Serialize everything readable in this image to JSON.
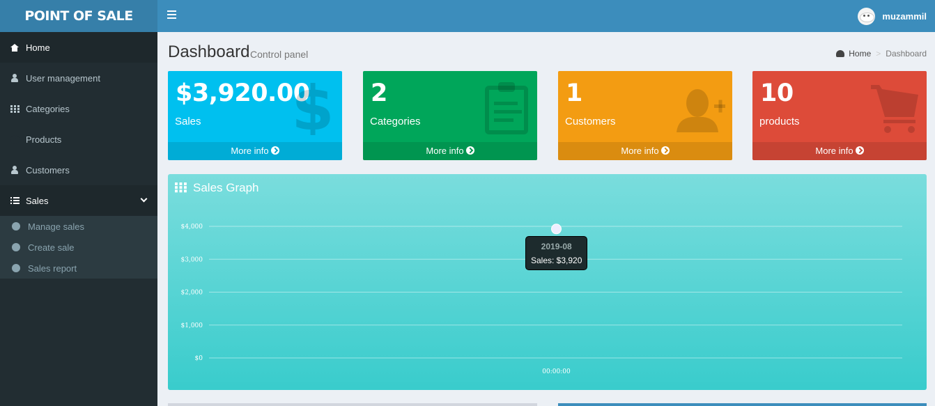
{
  "app": {
    "logo_text": "POINT OF SALE"
  },
  "header": {
    "user_name": "muzammil"
  },
  "sidebar": {
    "items": [
      {
        "label": "Home",
        "icon": "home-icon"
      },
      {
        "label": "User management",
        "icon": "user-icon"
      },
      {
        "label": "Categories",
        "icon": "th-icon"
      },
      {
        "label": "Products",
        "icon": "product-p-icon"
      },
      {
        "label": "Customers",
        "icon": "user-icon"
      },
      {
        "label": "Sales",
        "icon": "list-icon"
      }
    ],
    "sales_submenu": [
      {
        "label": "Manage sales"
      },
      {
        "label": "Create sale"
      },
      {
        "label": "Sales report"
      }
    ]
  },
  "page": {
    "title": "Dashboard",
    "subtitle": "Control panel",
    "breadcrumb": {
      "home": "Home",
      "current": "Dashboard"
    }
  },
  "boxes": [
    {
      "value": "$3,920.00",
      "label": "Sales",
      "more": "More info",
      "icon": "dollar-icon",
      "color": "#00c0ef"
    },
    {
      "value": "2",
      "label": "Categories",
      "more": "More info",
      "icon": "clipboard-icon",
      "color": "#00a65a"
    },
    {
      "value": "1",
      "label": "Customers",
      "more": "More info",
      "icon": "user-plus-icon",
      "color": "#f39c12"
    },
    {
      "value": "10",
      "label": "products",
      "more": "More info",
      "icon": "cart-icon",
      "color": "#dd4b39"
    }
  ],
  "graph": {
    "title": "Sales Graph",
    "tooltip": {
      "date": "2019-08",
      "text": "Sales: $3,920"
    }
  },
  "chart_data": {
    "type": "line",
    "x": [
      "00:00:00"
    ],
    "series": [
      {
        "values": [
          3920
        ]
      }
    ],
    "yticks": [
      "$0",
      "$1,000",
      "$2,000",
      "$3,000",
      "$4,000"
    ],
    "ylim": [
      0,
      4000
    ],
    "grid": true
  }
}
